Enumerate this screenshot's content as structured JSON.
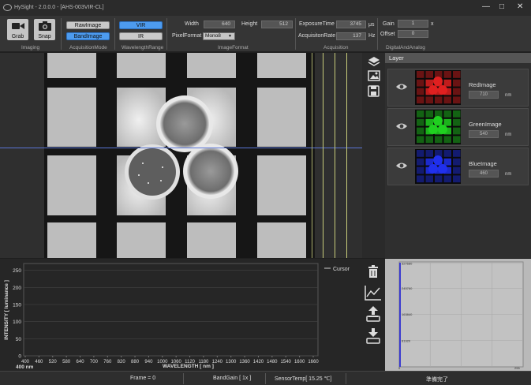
{
  "app": {
    "title": "HySight - 2.0.0.0 - [AHS-003VIR-CL]"
  },
  "window": {
    "minimize": "—",
    "maximize": "□",
    "close": "✕"
  },
  "ribbon": {
    "imaging": {
      "group_label": "Imaging",
      "grab_label": "Grab",
      "snap_label": "Snap"
    },
    "acquisition_mode": {
      "group_label": "AcquisitionMode",
      "raw_label": "RawImage",
      "band_label": "BandImage",
      "selected": "BandImage"
    },
    "wavelength_range": {
      "group_label": "WavelengthRange",
      "vir_label": "VIR",
      "ir_label": "IR",
      "selected": "VIR"
    },
    "image_format": {
      "group_label": "ImageFormat",
      "width_label": "Width",
      "width_value": "640",
      "height_label": "Height",
      "height_value": "512",
      "pixelformat_label": "PixelFormat",
      "pixelformat_value": "Mono8"
    },
    "acquisition": {
      "group_label": "Acquisition",
      "exposure_label": "ExposureTime",
      "exposure_value": "3745",
      "exposure_unit": "μs",
      "rate_label": "AcquisitonRate",
      "rate_value": "137",
      "rate_unit": "Hz"
    },
    "digital_analog": {
      "group_label": "DigitalAndAnalog",
      "gain_label": "Gain",
      "gain_value": "1",
      "gain_unit": "x",
      "offset_label": "Offset",
      "offset_value": "0"
    }
  },
  "layer_panel": {
    "header": "Layer",
    "layers": [
      {
        "name": "RedImage",
        "wavelength": "710",
        "unit": "nm",
        "color": "#e02020"
      },
      {
        "name": "GreenImage",
        "wavelength": "540",
        "unit": "nm",
        "color": "#20d020"
      },
      {
        "name": "BlueImage",
        "wavelength": "460",
        "unit": "nm",
        "color": "#2030ee"
      }
    ]
  },
  "tools": {
    "layers": "layers-icon",
    "image": "image-icon",
    "save": "save-icon",
    "delete": "trash-icon",
    "chart": "chart-line-icon",
    "export": "upload-icon",
    "import": "download-icon"
  },
  "spectrum": {
    "y_label": "INTENSITY [ luminance ]",
    "x_label": "WAVELENGTH [ nm ]",
    "legend": "Cursor",
    "cursor_readout": "400 nm",
    "y_ticks": [
      "0",
      "50",
      "100",
      "150",
      "200",
      "250"
    ],
    "x_ticks": [
      "400",
      "460",
      "520",
      "580",
      "640",
      "700",
      "760",
      "820",
      "880",
      "940",
      "1000",
      "1060",
      "1120",
      "1180",
      "1240",
      "1300",
      "1360",
      "1420",
      "1480",
      "1540",
      "1600",
      "1660"
    ]
  },
  "histogram": {
    "y_ticks": [
      "327680",
      "245760",
      "163840",
      "81920"
    ],
    "x_min": "0",
    "x_max": "255"
  },
  "status": {
    "frame": "Frame = 0",
    "band_gain": "BandGain [ 1x ]",
    "sensor_temp": "SensorTemp[ 15.25 ℃]",
    "state": "準備完了"
  },
  "colors": {
    "accent": "#4d9bef",
    "guide": "#5a75d6",
    "histo_bar": "#3a3acf"
  }
}
